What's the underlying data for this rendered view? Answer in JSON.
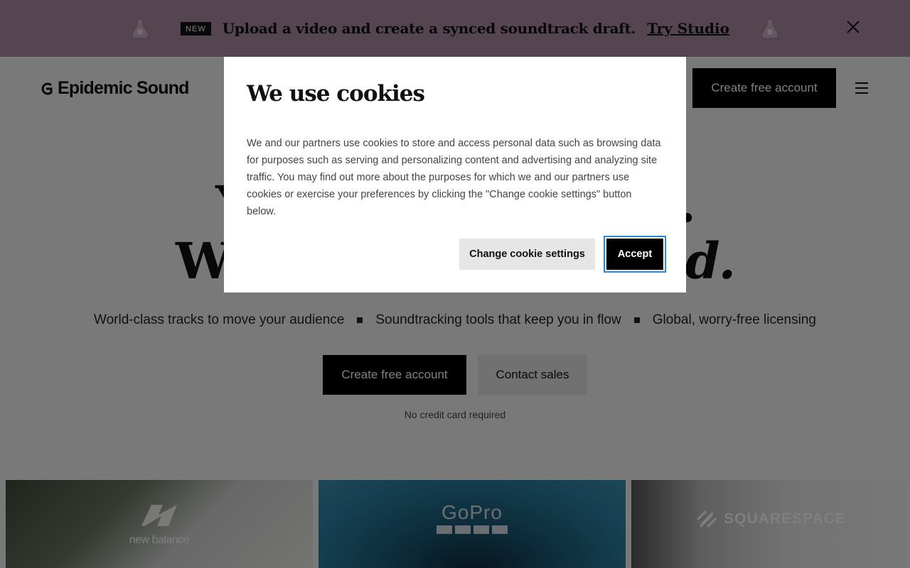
{
  "banner": {
    "badge": "NEW",
    "text": "Upload a video and create a synced soundtrack draft.",
    "link": "Try Studio",
    "close_icon": "close-icon",
    "decoration_icon": "potion-icon",
    "background": "#ab8aa2"
  },
  "header": {
    "logo_text": "Epidemic Sound",
    "cta": "Create free account",
    "menu_icon": "hamburger-menu-icon"
  },
  "hero": {
    "line1_start": "Y",
    "line1_end": "a.",
    "line2_start": "W",
    "line2_end": "d.",
    "features": [
      "World-class tracks to move your audience",
      "Soundtracking tools that keep you in flow",
      "Global, worry-free licensing"
    ],
    "primary_cta": "Create free account",
    "secondary_cta": "Contact sales",
    "note": "No credit card required"
  },
  "brands": [
    {
      "name": "new balance"
    },
    {
      "name": "GoPro"
    },
    {
      "name": "SQUARESPACE"
    }
  ],
  "cookie_modal": {
    "title": "We use cookies",
    "body": "We and our partners use cookies to store and access personal data such as browsing data for purposes such as serving and personalizing content and advertising and analyzing site traffic. You may find out more about the purposes for which we and our partners use cookies or exercise your preferences by clicking the \"Change cookie settings\" button below.",
    "settings_button": "Change cookie settings",
    "accept_button": "Accept"
  }
}
